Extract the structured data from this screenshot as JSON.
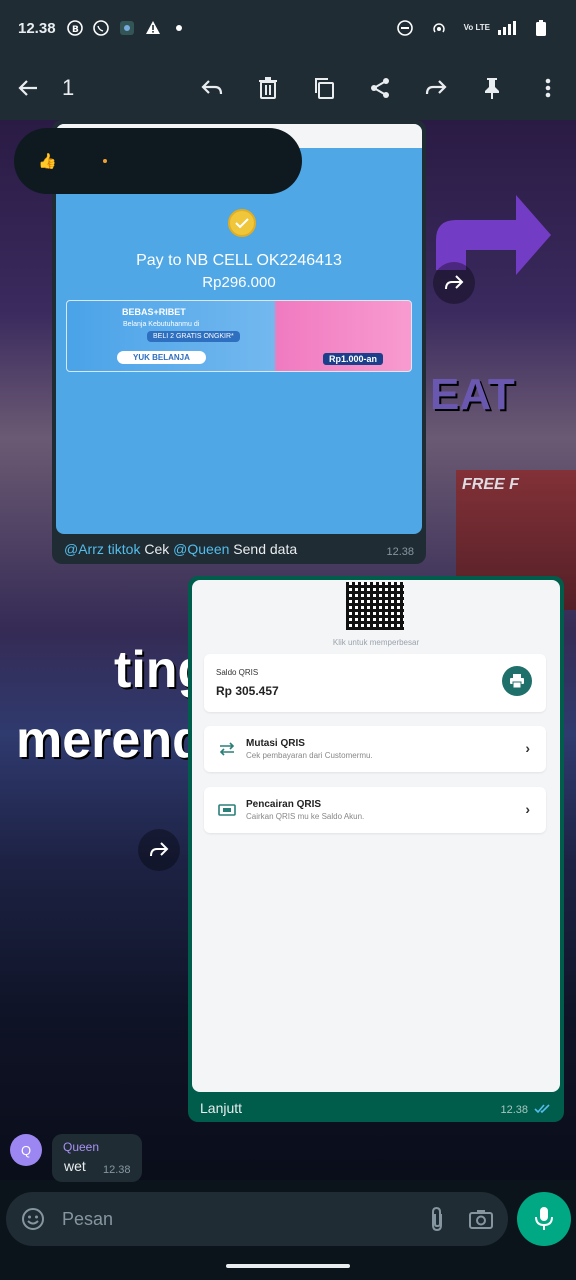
{
  "status_bar": {
    "time": "12.38",
    "network_text": "Vo LTE"
  },
  "action_bar": {
    "selected_count": "1",
    "icons": [
      "back-icon",
      "reply-icon",
      "delete-icon",
      "copy-icon",
      "share-icon",
      "forward-icon",
      "pin-icon",
      "more-icon"
    ]
  },
  "reaction": {
    "emoji": "👍"
  },
  "messages": [
    {
      "type": "image",
      "direction": "incoming",
      "payment_title": "Pay to NB CELL OK2246413",
      "payment_amount": "Rp296.000",
      "promo": {
        "headline": "BEBAS+RIBET",
        "line1": "Belanja Kebutuhanmu di",
        "badge": "BELI 2 GRATIS ONGKIR*",
        "cta": "YUK BELANJA",
        "price": "Rp1.000-an"
      },
      "mention1": "@Arrz tiktok",
      "mid_text": " Cek ",
      "mention2": "@Queen",
      "end_text": " Send data",
      "time": "12.38"
    },
    {
      "type": "image",
      "direction": "outgoing",
      "qr_hint": "Klik untuk memperbesar",
      "saldo_label": "Saldo QRIS",
      "saldo_value": "Rp 305.457",
      "row1_title": "Mutasi QRIS",
      "row1_sub": "Cek pembayaran dari Customermu.",
      "row2_title": "Pencairan QRIS",
      "row2_sub": "Cairkan QRIS mu ke Saldo Akun.",
      "caption": "Lanjutt",
      "time": "12.38"
    },
    {
      "type": "text",
      "direction": "incoming",
      "avatar_letter": "Q",
      "sender": "Queen",
      "text": "wet",
      "time": "12.38"
    }
  ],
  "background_text": {
    "line1": "ting",
    "line2": "merend",
    "right": "EAT",
    "ff": "FREE F"
  },
  "input": {
    "placeholder": "Pesan"
  },
  "colors": {
    "header": "#1f2c34",
    "incoming_bubble": "#1f2c34",
    "outgoing_bubble": "#005c4b",
    "accent": "#00a884",
    "mention": "#53bdeb"
  }
}
